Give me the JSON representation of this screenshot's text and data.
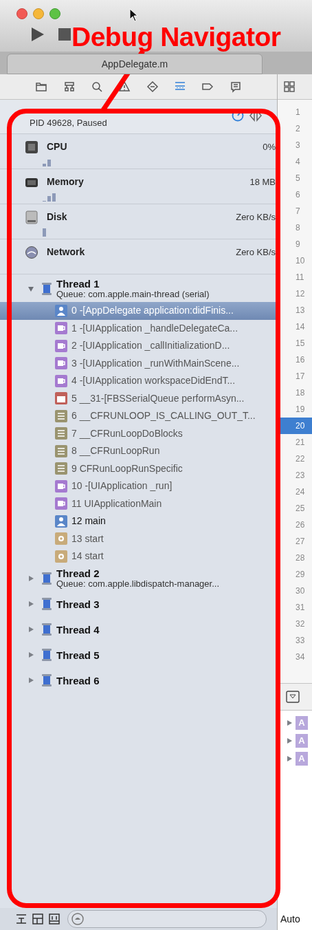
{
  "annotation": {
    "label": "Debug Navigator"
  },
  "editor_tab": {
    "title": "AppDelegate.m"
  },
  "navigator_tabs": [
    {
      "selected": false
    },
    {
      "selected": false
    },
    {
      "selected": false
    },
    {
      "selected": false
    },
    {
      "selected": false
    },
    {
      "selected": true
    },
    {
      "selected": false
    },
    {
      "selected": false
    }
  ],
  "process": {
    "status": "PID 49628, Paused"
  },
  "gauges": [
    {
      "kind": "cpu",
      "name": "CPU",
      "value": "0%"
    },
    {
      "kind": "memory",
      "name": "Memory",
      "value": "18 MB"
    },
    {
      "kind": "disk",
      "name": "Disk",
      "value": "Zero KB/s"
    },
    {
      "kind": "network",
      "name": "Network",
      "value": "Zero KB/s"
    }
  ],
  "threads": [
    {
      "name": "Thread 1",
      "queue": "Queue: com.apple.main-thread (serial)",
      "expanded": true,
      "children": [
        {
          "kind": "user",
          "label": "0 -[AppDelegate application:didFinis...",
          "selected": true
        },
        {
          "kind": "framework",
          "label": "1 -[UIApplication _handleDelegateCa...",
          "selected": false
        },
        {
          "kind": "framework",
          "label": "2 -[UIApplication _callInitializationD...",
          "selected": false
        },
        {
          "kind": "framework",
          "label": "3 -[UIApplication _runWithMainScene...",
          "selected": false
        },
        {
          "kind": "framework",
          "label": "4 -[UIApplication workspaceDidEndT...",
          "selected": false
        },
        {
          "kind": "queue",
          "label": "5 __31-[FBSSerialQueue performAsyn...",
          "selected": false
        },
        {
          "kind": "runloop",
          "label": "6 __CFRUNLOOP_IS_CALLING_OUT_T...",
          "selected": false
        },
        {
          "kind": "runloop",
          "label": "7 __CFRunLoopDoBlocks",
          "selected": false
        },
        {
          "kind": "runloop",
          "label": "8 __CFRunLoopRun",
          "selected": false
        },
        {
          "kind": "runloop",
          "label": "9 CFRunLoopRunSpecific",
          "selected": false
        },
        {
          "kind": "framework",
          "label": "10 -[UIApplication _run]",
          "selected": false
        },
        {
          "kind": "framework",
          "label": "11 UIApplicationMain",
          "selected": false
        },
        {
          "kind": "user",
          "label": "12 main",
          "selected": false
        },
        {
          "kind": "system",
          "label": "13 start",
          "selected": false
        },
        {
          "kind": "system",
          "label": "14 start",
          "selected": false
        }
      ]
    },
    {
      "name": "Thread 2",
      "queue": "Queue: com.apple.libdispatch-manager...",
      "expanded": false
    },
    {
      "name": "Thread 3",
      "expanded": false
    },
    {
      "name": "Thread 4",
      "expanded": false
    },
    {
      "name": "Thread 5",
      "expanded": false
    },
    {
      "name": "Thread 6",
      "expanded": false
    }
  ],
  "gutter": {
    "lines": [
      {
        "text": "1",
        "selected": false
      },
      {
        "text": "2",
        "selected": false
      },
      {
        "text": "3",
        "selected": false
      },
      {
        "text": "4",
        "selected": false
      },
      {
        "text": "5",
        "selected": false
      },
      {
        "text": "6",
        "selected": false
      },
      {
        "text": "7",
        "selected": false
      },
      {
        "text": "8",
        "selected": false
      },
      {
        "text": "9",
        "selected": false
      },
      {
        "text": "10",
        "selected": false
      },
      {
        "text": "11",
        "selected": false
      },
      {
        "text": "12",
        "selected": false
      },
      {
        "text": "13",
        "selected": false
      },
      {
        "text": "14",
        "selected": false
      },
      {
        "text": "15",
        "selected": false
      },
      {
        "text": "16",
        "selected": false
      },
      {
        "text": "17",
        "selected": false
      },
      {
        "text": "18",
        "selected": false
      },
      {
        "text": "19",
        "selected": false
      },
      {
        "text": "20",
        "selected": true
      },
      {
        "text": "21",
        "selected": false
      },
      {
        "text": "22",
        "selected": false
      },
      {
        "text": "23",
        "selected": false
      },
      {
        "text": "24",
        "selected": false
      },
      {
        "text": "25",
        "selected": false
      },
      {
        "text": "26",
        "selected": false
      },
      {
        "text": "27",
        "selected": false
      },
      {
        "text": "28",
        "selected": false
      },
      {
        "text": "29",
        "selected": false
      },
      {
        "text": "30",
        "selected": false
      },
      {
        "text": "31",
        "selected": false
      },
      {
        "text": "32",
        "selected": false
      },
      {
        "text": "33",
        "selected": false
      },
      {
        "text": "34",
        "selected": false
      }
    ]
  },
  "variables": [
    {
      "label": "A"
    },
    {
      "label": "A"
    },
    {
      "label": "A"
    }
  ],
  "status_bar": {
    "scope": "Auto"
  }
}
